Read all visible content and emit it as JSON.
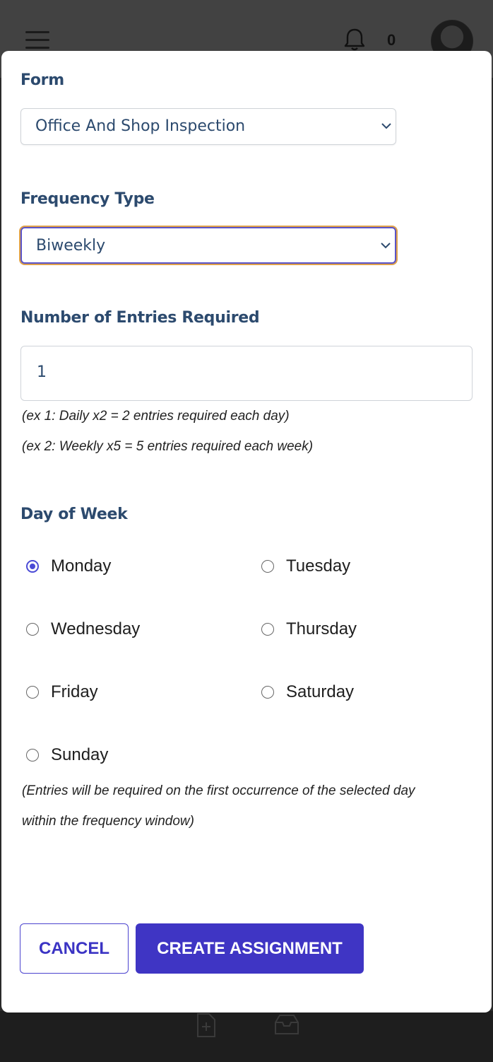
{
  "header": {
    "notification_count": "0"
  },
  "form_section": {
    "label": "Form",
    "selected": "Office And Shop Inspection"
  },
  "frequency_section": {
    "label": "Frequency Type",
    "selected": "Biweekly"
  },
  "entries_section": {
    "label": "Number of Entries Required",
    "value": "1",
    "hint1": "(ex 1: Daily x2 = 2 entries required each day)",
    "hint2": "(ex 2: Weekly x5 = 5 entries required each week)"
  },
  "day_section": {
    "label": "Day of Week",
    "days": [
      {
        "label": "Monday",
        "checked": true
      },
      {
        "label": "Tuesday",
        "checked": false
      },
      {
        "label": "Wednesday",
        "checked": false
      },
      {
        "label": "Thursday",
        "checked": false
      },
      {
        "label": "Friday",
        "checked": false
      },
      {
        "label": "Saturday",
        "checked": false
      },
      {
        "label": "Sunday",
        "checked": false
      }
    ],
    "note_line1": "(Entries will be required on the first occurrence of the selected day",
    "note_line2": "within the frequency window)"
  },
  "actions": {
    "cancel_label": "CANCEL",
    "create_label": "CREATE ASSIGNMENT"
  },
  "colors": {
    "accent": "#3f35c4",
    "label_color": "#2c4a6e",
    "focus_ring": "#e0a24a"
  },
  "icons": {
    "menu": "hamburger-menu-icon",
    "notifications": "bell-icon",
    "select_arrow": "chevron-down-icon",
    "bottom_nav_1": "file-add-icon",
    "bottom_nav_2": "inbox-tray-icon"
  }
}
